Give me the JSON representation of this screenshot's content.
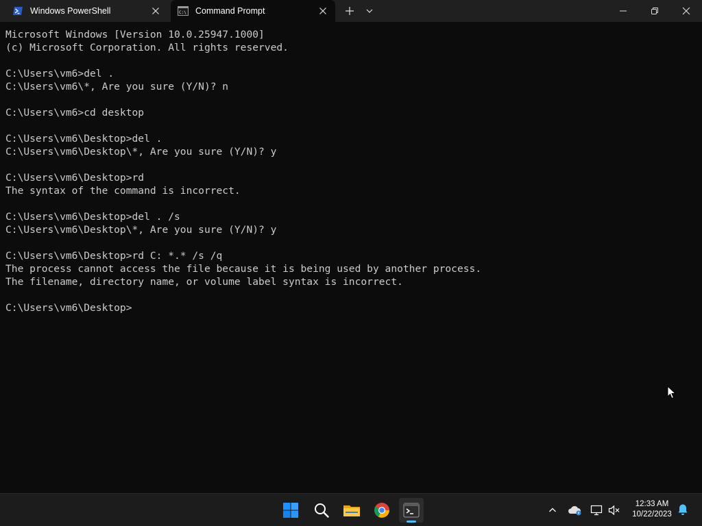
{
  "window": {
    "tabs": [
      {
        "label": "Windows PowerShell",
        "active": false
      },
      {
        "label": "Command Prompt",
        "active": true
      }
    ],
    "new_tab_icon": "plus-icon",
    "dropdown_icon": "chevron-down-icon",
    "controls": [
      "minimize-icon",
      "restore-icon",
      "close-icon"
    ]
  },
  "terminal": {
    "lines": [
      "Microsoft Windows [Version 10.0.25947.1000]",
      "(c) Microsoft Corporation. All rights reserved.",
      "",
      "C:\\Users\\vm6>del .",
      "C:\\Users\\vm6\\*, Are you sure (Y/N)? n",
      "",
      "C:\\Users\\vm6>cd desktop",
      "",
      "C:\\Users\\vm6\\Desktop>del .",
      "C:\\Users\\vm6\\Desktop\\*, Are you sure (Y/N)? y",
      "",
      "C:\\Users\\vm6\\Desktop>rd",
      "The syntax of the command is incorrect.",
      "",
      "C:\\Users\\vm6\\Desktop>del . /s",
      "C:\\Users\\vm6\\Desktop\\*, Are you sure (Y/N)? y",
      "",
      "C:\\Users\\vm6\\Desktop>rd C: *.* /s /q",
      "The process cannot access the file because it is being used by another process.",
      "The filename, directory name, or volume label syntax is incorrect.",
      "",
      "C:\\Users\\vm6\\Desktop>"
    ]
  },
  "taskbar": {
    "apps": [
      "windows-start-icon",
      "search-icon",
      "file-explorer-icon",
      "chrome-icon",
      "terminal-icon"
    ],
    "tray": [
      "chevron-up-icon",
      "onedrive-icon",
      "network-icon",
      "volume-muted-icon"
    ],
    "time": "12:33 AM",
    "date": "10/22/2023",
    "notification_icon": "bell-icon"
  },
  "colors": {
    "terminal_bg": "#0c0c0c",
    "terminal_fg": "#cccccc",
    "titlebar_bg": "#202020",
    "taskbar_bg": "#1c1c1c",
    "accent": "#4cc2ff"
  }
}
